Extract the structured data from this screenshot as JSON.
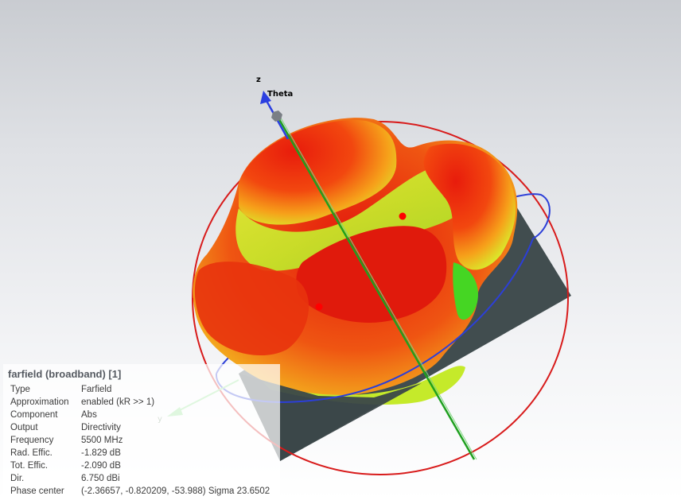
{
  "axes": {
    "z": "z",
    "theta": "Theta",
    "y": "y"
  },
  "colors": {
    "pattern_high": "#e41b0d",
    "pattern_mid": "#f58a15",
    "pattern_low": "#d8ef2a",
    "pattern_min": "#3ed41f",
    "theta_circle": "#d81b1b",
    "phi_circle": "#2c3fd8",
    "z_axis": "#2b3fe0",
    "y_axis": "#7ee07e",
    "center_axis": "#1fa01f",
    "ground_plane": "#3a4749"
  },
  "info": {
    "title": "farfield (broadband) [1]",
    "rows": [
      {
        "key": "Type",
        "value": "Farfield"
      },
      {
        "key": "Approximation",
        "value": "enabled (kR >> 1)"
      },
      {
        "key": "Component",
        "value": "Abs"
      },
      {
        "key": "Output",
        "value": "Directivity"
      },
      {
        "key": "Frequency",
        "value": "5500 MHz"
      },
      {
        "key": "Rad. Effic.",
        "value": "-1.829 dB"
      },
      {
        "key": "Tot. Effic.",
        "value": "-2.090 dB"
      },
      {
        "key": "Dir.",
        "value": "6.750 dBi"
      },
      {
        "key": "Phase center",
        "value": "(-2.36657, -0.820209, -53.988) Sigma 23.6502"
      }
    ]
  }
}
